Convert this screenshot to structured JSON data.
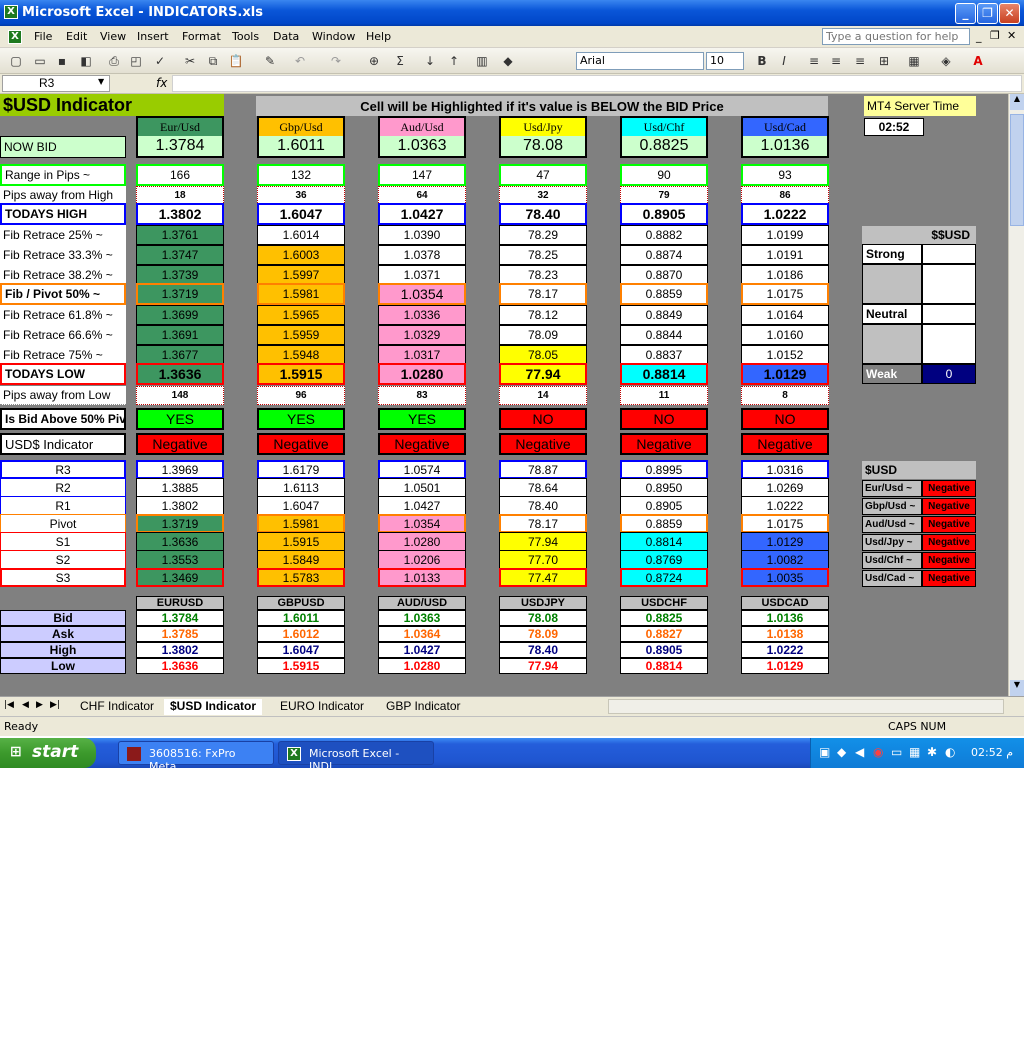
{
  "window": {
    "title": "Microsoft Excel - INDICATORS.xls"
  },
  "menu": [
    "File",
    "Edit",
    "View",
    "Insert",
    "Format",
    "Tools",
    "Data",
    "Window",
    "Help"
  ],
  "help_placeholder": "Type a question for help",
  "font": {
    "name": "Arial",
    "size": "10"
  },
  "namebox": "R3",
  "fx": "fx",
  "sheet": {
    "title": "$USD  Indicator",
    "banner": "Cell will be Highlighted if it's value is BELOW the BID Price",
    "server_time_label": "MT4 Server Time",
    "server_time": "02:52",
    "pairs": [
      "Eur/Usd",
      "Gbp/Usd",
      "Aud/Usd",
      "Usd/Jpy",
      "Usd/Chf",
      "Usd/Cad"
    ],
    "row_labels": {
      "now_bid": "NOW BID",
      "range": "Range in Pips ~",
      "pips_high": "Pips away from High",
      "todays_high": "TODAYS HIGH",
      "fib25": "Fib Retrace 25% ~",
      "fib33": "Fib Retrace 33.3% ~",
      "fib38": "Fib Retrace 38.2% ~",
      "fib50": "Fib / Pivot 50% ~",
      "fib61": "Fib Retrace 61.8% ~",
      "fib66": "Fib Retrace 66.6% ~",
      "fib75": "Fib Retrace 75% ~",
      "todays_low": "TODAYS LOW",
      "pips_low": "Pips away from Low",
      "above50": "Is Bid Above 50% Piv",
      "usd_ind": "USD$ Indicator",
      "r3": "R3",
      "r2": "R2",
      "r1": "R1",
      "pivot": "Pivot",
      "s1": "S1",
      "s2": "S2",
      "s3": "S3"
    },
    "now_bid": [
      "1.3784",
      "1.6011",
      "1.0363",
      "78.08",
      "0.8825",
      "1.0136"
    ],
    "range": [
      "166",
      "132",
      "147",
      "47",
      "90",
      "93"
    ],
    "pips_high": [
      "18",
      "36",
      "64",
      "32",
      "79",
      "86"
    ],
    "todays_high": [
      "1.3802",
      "1.6047",
      "1.0427",
      "78.40",
      "0.8905",
      "1.0222"
    ],
    "fib25": [
      "1.3761",
      "1.6014",
      "1.0390",
      "78.29",
      "0.8882",
      "1.0199"
    ],
    "fib33": [
      "1.3747",
      "1.6003",
      "1.0378",
      "78.25",
      "0.8874",
      "1.0191"
    ],
    "fib38": [
      "1.3739",
      "1.5997",
      "1.0371",
      "78.23",
      "0.8870",
      "1.0186"
    ],
    "fib50": [
      "1.3719",
      "1.5981",
      "1.0354",
      "78.17",
      "0.8859",
      "1.0175"
    ],
    "fib61": [
      "1.3699",
      "1.5965",
      "1.0336",
      "78.12",
      "0.8849",
      "1.0164"
    ],
    "fib66": [
      "1.3691",
      "1.5959",
      "1.0329",
      "78.09",
      "0.8844",
      "1.0160"
    ],
    "fib75": [
      "1.3677",
      "1.5948",
      "1.0317",
      "78.05",
      "0.8837",
      "1.0152"
    ],
    "todays_low": [
      "1.3636",
      "1.5915",
      "1.0280",
      "77.94",
      "0.8814",
      "1.0129"
    ],
    "pips_low": [
      "148",
      "96",
      "83",
      "14",
      "11",
      "8"
    ],
    "above50": [
      "YES",
      "YES",
      "YES",
      "NO",
      "NO",
      "NO"
    ],
    "usd_ind": [
      "Negative",
      "Negative",
      "Negative",
      "Negative",
      "Negative",
      "Negative"
    ],
    "r3": [
      "1.3969",
      "1.6179",
      "1.0574",
      "78.87",
      "0.8995",
      "1.0316"
    ],
    "r2": [
      "1.3885",
      "1.6113",
      "1.0501",
      "78.64",
      "0.8950",
      "1.0269"
    ],
    "r1": [
      "1.3802",
      "1.6047",
      "1.0427",
      "78.40",
      "0.8905",
      "1.0222"
    ],
    "pivot": [
      "1.3719",
      "1.5981",
      "1.0354",
      "78.17",
      "0.8859",
      "1.0175"
    ],
    "s1": [
      "1.3636",
      "1.5915",
      "1.0280",
      "77.94",
      "0.8814",
      "1.0129"
    ],
    "s2": [
      "1.3553",
      "1.5849",
      "1.0206",
      "77.70",
      "0.8769",
      "1.0082"
    ],
    "s3": [
      "1.3469",
      "1.5783",
      "1.0133",
      "77.47",
      "0.8724",
      "1.0035"
    ],
    "quote_headers": [
      "EURUSD",
      "GBPUSD",
      "AUD/USD",
      "USDJPY",
      "USDCHF",
      "USDCAD"
    ],
    "quote_labels": [
      "Bid",
      "Ask",
      "High",
      "Low"
    ],
    "quotes": {
      "bid": [
        "1.3784",
        "1.6011",
        "1.0363",
        "78.08",
        "0.8825",
        "1.0136"
      ],
      "ask": [
        "1.3785",
        "1.6012",
        "1.0364",
        "78.09",
        "0.8827",
        "1.0138"
      ],
      "high": [
        "1.3802",
        "1.6047",
        "1.0427",
        "78.40",
        "0.8905",
        "1.0222"
      ],
      "low": [
        "1.3636",
        "1.5915",
        "1.0280",
        "77.94",
        "0.8814",
        "1.0129"
      ]
    },
    "ssusd": {
      "title": "$$USD",
      "strong": "Strong",
      "neutral": "Neutral",
      "weak": "Weak",
      "weak_value": "0"
    },
    "usd_panel": {
      "title": "$USD",
      "rows": [
        {
          "pair": "Eur/Usd ~",
          "val": "Negative"
        },
        {
          "pair": "Gbp/Usd ~",
          "val": "Negative"
        },
        {
          "pair": "Aud/Usd ~",
          "val": "Negative"
        },
        {
          "pair": "Usd/Jpy ~",
          "val": "Negative"
        },
        {
          "pair": "Usd/Chf ~",
          "val": "Negative"
        },
        {
          "pair": "Usd/Cad ~",
          "val": "Negative"
        }
      ]
    }
  },
  "tabs": [
    "CHF Indicator",
    "$USD Indicator",
    "EURO Indicator",
    "GBP Indicator"
  ],
  "status": {
    "left": "Ready",
    "right": "CAPS  NUM"
  },
  "taskbar": {
    "start": "start",
    "tasks": [
      "3608516: FxPro Meta...",
      "Microsoft Excel - INDI..."
    ],
    "clock": "02:52 م"
  },
  "colors": {
    "quote_bid": "#008000",
    "quote_ask": "#ff6600",
    "quote_high": "#000080",
    "quote_low": "#ff0000"
  }
}
